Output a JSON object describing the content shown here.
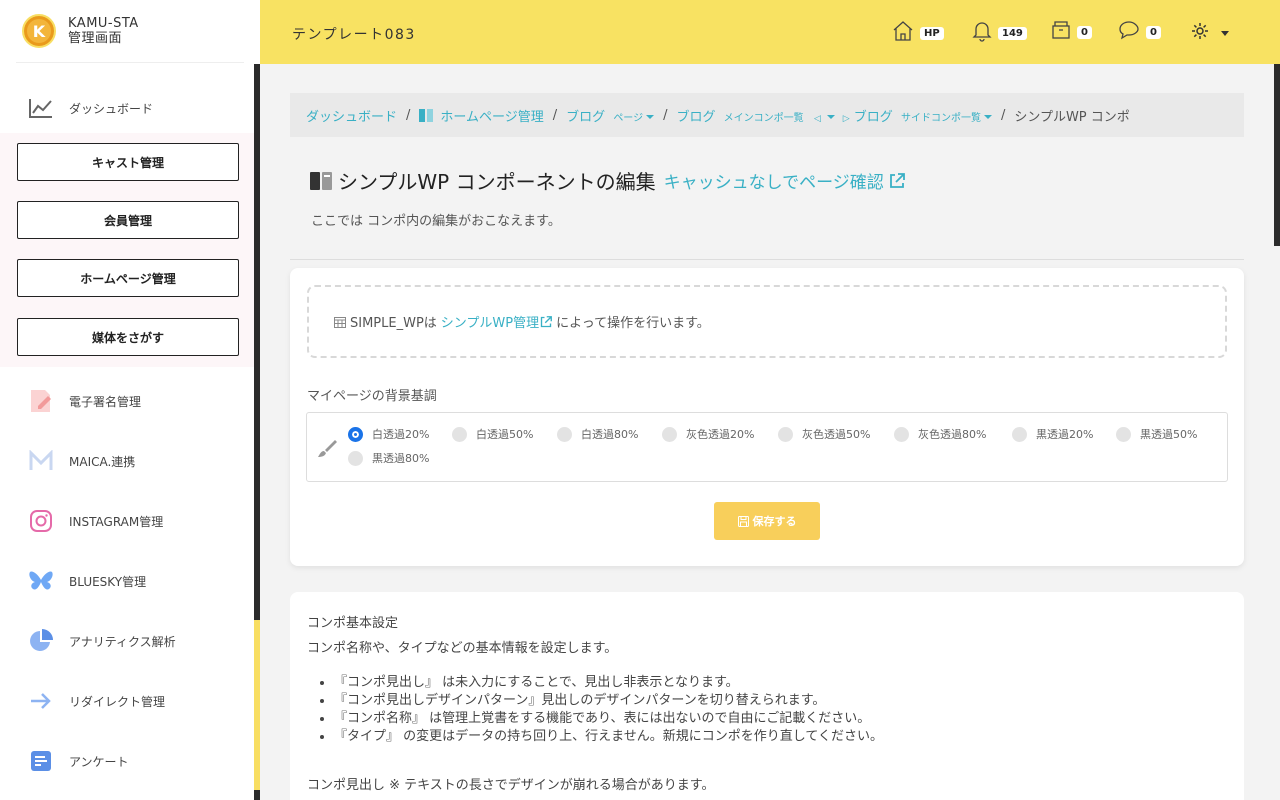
{
  "brand": {
    "logo_letter": "K",
    "line1": "KAMU-STA",
    "line2": "管理画面"
  },
  "sidebar": {
    "dashboard": "ダッシュボード",
    "boxed": [
      "キャスト管理",
      "会員管理",
      "ホームページ管理",
      "媒体をさがす"
    ],
    "items": [
      {
        "label": "電子署名管理",
        "icon": "signature-icon"
      },
      {
        "label": "MAICA.連携",
        "icon": "maica-icon"
      },
      {
        "label": "INSTAGRAM管理",
        "icon": "instagram-icon"
      },
      {
        "label": "BLUESKY管理",
        "icon": "bluesky-icon"
      },
      {
        "label": "アナリティクス解析",
        "icon": "pie-chart-icon"
      },
      {
        "label": "リダイレクト管理",
        "icon": "arrow-right-icon"
      },
      {
        "label": "アンケート",
        "icon": "survey-icon"
      }
    ]
  },
  "header": {
    "title": "テンプレート083",
    "hp_badge": "HP",
    "notifications": "149",
    "box_count": "0",
    "chat_count": "0"
  },
  "breadcrumb": {
    "b1": "ダッシュボード",
    "b2": "ホームページ管理",
    "b3": "ブログ",
    "b3_small": "ページ",
    "b4": "ブログ",
    "b4_small": "メインコンポ一覧",
    "b5": "ブログ",
    "b5_small": "サイドコンポ一覧",
    "current": "シンプルWP コンポ"
  },
  "page": {
    "title": "シンプルWP コンポーネントの編集",
    "link": "キャッシュなしでページ確認",
    "desc": "ここでは コンポ内の編集がおこなえます。"
  },
  "info": {
    "prefix": "SIMPLE_WPは",
    "link": "シンプルWP管理",
    "suffix": "によって操作を行います。"
  },
  "bg_setting": {
    "label": "マイページの背景基調",
    "options": [
      "白透過20%",
      "白透過50%",
      "白透過80%",
      "灰色透過20%",
      "灰色透過50%",
      "灰色透過80%",
      "黒透過20%",
      "黒透過50%",
      "黒透過80%"
    ],
    "selected": "白透過20%",
    "save": "保存する"
  },
  "basic": {
    "title": "コンポ基本設定",
    "desc": "コンポ名称や、タイプなどの基本情報を設定します。",
    "bullets": [
      "『コンポ見出し』 は未入力にすることで、見出し非表示となります。",
      "『コンポ見出しデザインパターン』見出しのデザインパターンを切り替えられます。",
      "『コンポ名称』 は管理上覚書をする機能であり、表には出ないので自由にご記載ください。",
      "『タイプ』 の変更はデータの持ち回り上、行えません。新規にコンポを作り直してください。"
    ],
    "foot": "コンポ見出し ※ テキストの長さでデザインが崩れる場合があります。"
  },
  "colors": {
    "accent": "#39b0c5",
    "header_bg": "#f8e262",
    "save_bg": "#f8cf5b",
    "radio_on": "#1a73e8"
  }
}
